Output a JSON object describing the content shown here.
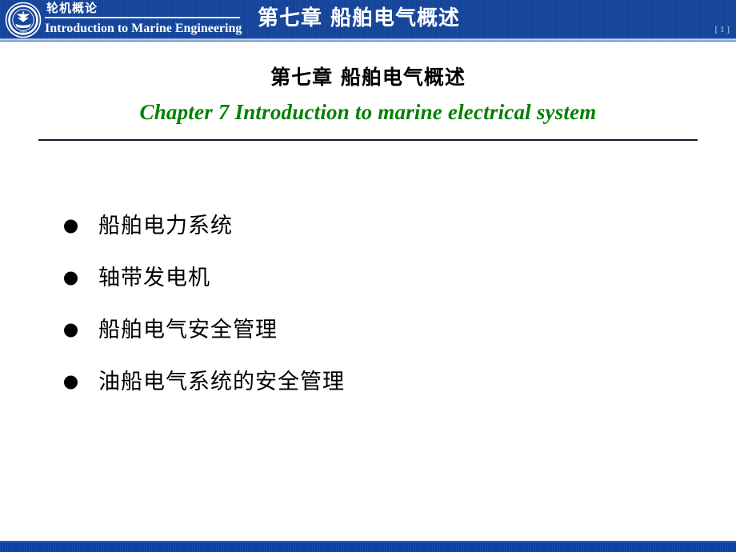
{
  "header": {
    "logo_icon": "nautical-institute-crest-icon",
    "course_title_cn": "轮机概论",
    "course_title_en": "Introduction to Marine Engineering",
    "banner_title": "第七章  船舶电气概述",
    "page_marker": "[ 1 ]",
    "background_color": "#14459d",
    "text_color": "#ffffff"
  },
  "slide": {
    "title_cn": "第七章  船舶电气概述",
    "title_en": "Chapter 7    Introduction to marine electrical system",
    "title_en_color": "#008000",
    "divider_color": "#0d1b2a",
    "bullets": [
      {
        "marker": "●",
        "label": "船舶电力系统"
      },
      {
        "marker": "●",
        "label": "轴带发电机"
      },
      {
        "marker": "●",
        "label": "船舶电气安全管理"
      },
      {
        "marker": "●",
        "label": "油船电气系统的安全管理"
      }
    ]
  },
  "footer": {
    "accent_color": "#0b3fa8"
  }
}
